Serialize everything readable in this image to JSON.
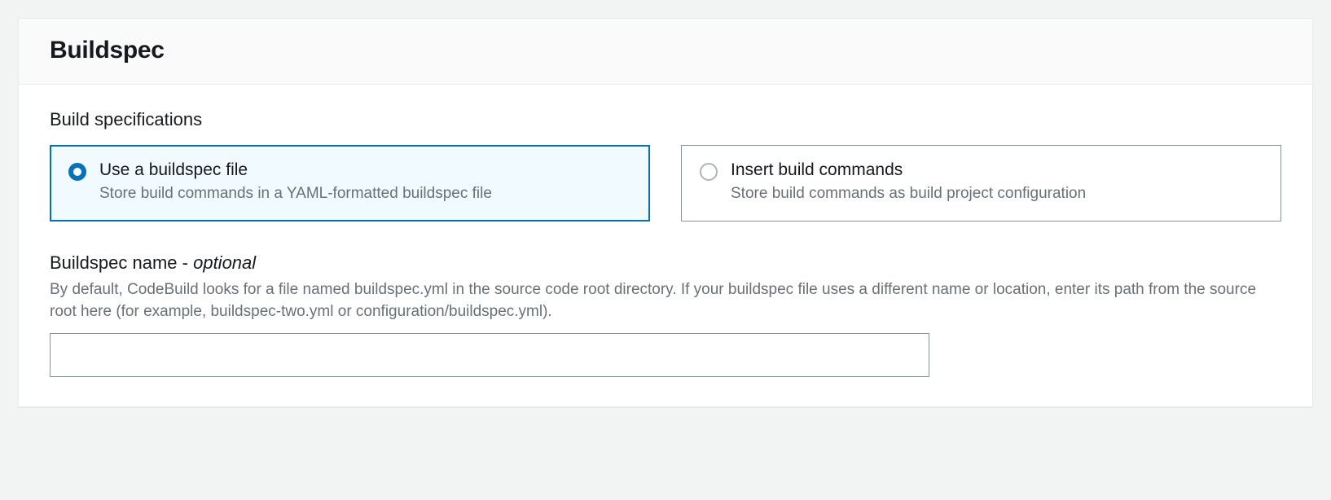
{
  "panel": {
    "title": "Buildspec"
  },
  "build_specifications": {
    "label": "Build specifications",
    "options": [
      {
        "title": "Use a buildspec file",
        "description": "Store build commands in a YAML-formatted buildspec file",
        "selected": true
      },
      {
        "title": "Insert build commands",
        "description": "Store build commands as build project configuration",
        "selected": false
      }
    ]
  },
  "buildspec_name": {
    "label_main": "Buildspec name - ",
    "label_optional": "optional",
    "help": "By default, CodeBuild looks for a file named buildspec.yml in the source code root directory. If your buildspec file uses a different name or location, enter its path from the source root here (for example, buildspec-two.yml or configuration/buildspec.yml).",
    "value": "",
    "placeholder": ""
  }
}
